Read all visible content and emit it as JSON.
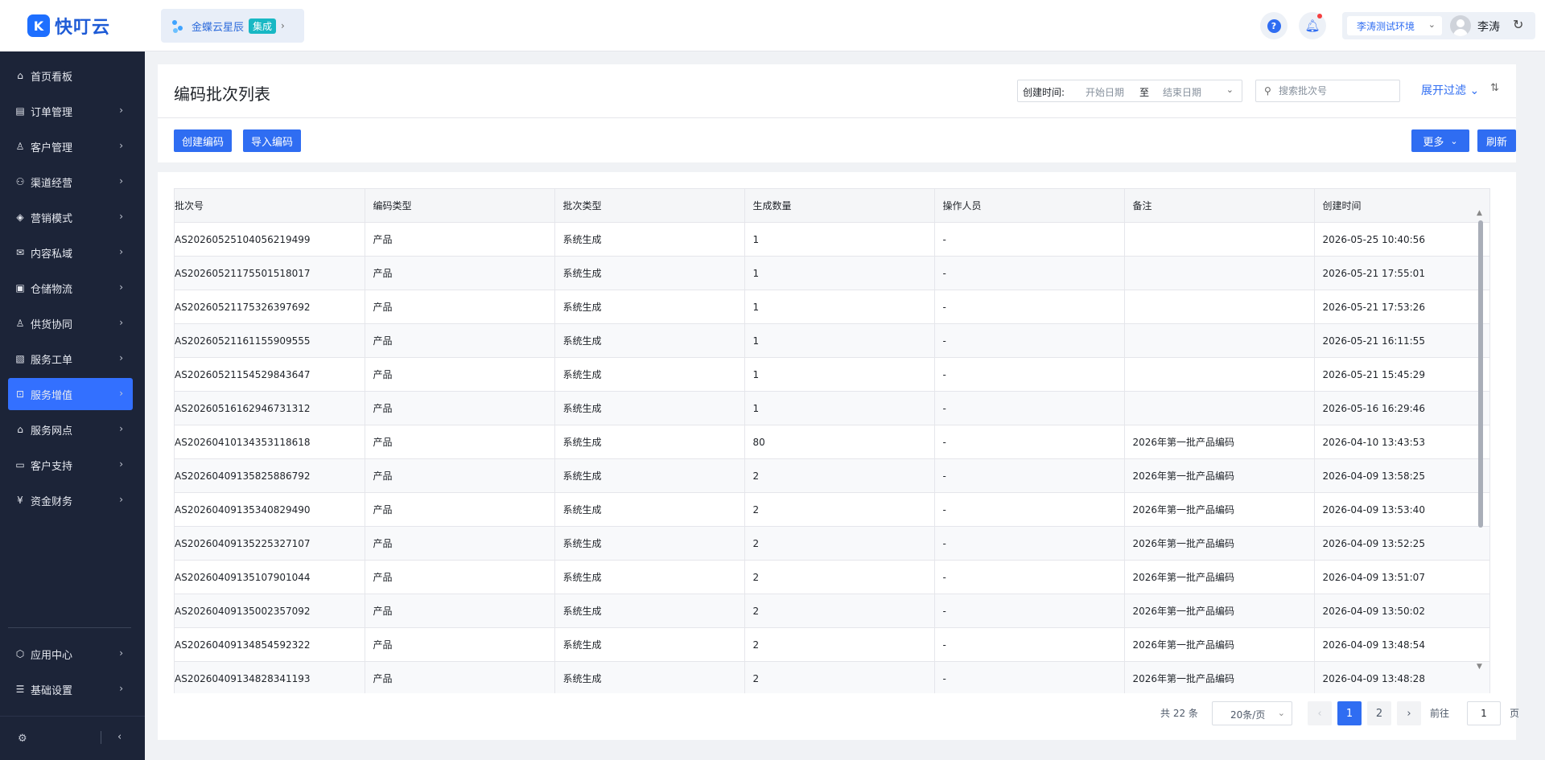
{
  "app": {
    "logo_text": "快叮云",
    "logo_mark": "K"
  },
  "sidebar": {
    "items": [
      {
        "label": "首页看板",
        "icon": "home-icon",
        "glyph": "⌂",
        "has_children": false,
        "active": false
      },
      {
        "label": "订单管理",
        "icon": "clipboard-icon",
        "glyph": "▤",
        "has_children": true,
        "active": false
      },
      {
        "label": "客户管理",
        "icon": "user-icon",
        "glyph": "♙",
        "has_children": true,
        "active": false
      },
      {
        "label": "渠道经营",
        "icon": "channel-icon",
        "glyph": "⚇",
        "has_children": true,
        "active": false
      },
      {
        "label": "营销模式",
        "icon": "tag-icon",
        "glyph": "◈",
        "has_children": true,
        "active": false
      },
      {
        "label": "内容私域",
        "icon": "mail-icon",
        "glyph": "✉",
        "has_children": true,
        "active": false
      },
      {
        "label": "仓储物流",
        "icon": "warehouse-icon",
        "glyph": "▣",
        "has_children": true,
        "active": false
      },
      {
        "label": "供货协同",
        "icon": "supplier-icon",
        "glyph": "♙",
        "has_children": true,
        "active": false
      },
      {
        "label": "服务工单",
        "icon": "ticket-icon",
        "glyph": "▧",
        "has_children": true,
        "active": false
      },
      {
        "label": "服务增值",
        "icon": "bag-icon",
        "glyph": "⊡",
        "has_children": true,
        "active": true
      },
      {
        "label": "服务网点",
        "icon": "store-icon",
        "glyph": "⌂",
        "has_children": true,
        "active": false
      },
      {
        "label": "客户支持",
        "icon": "support-icon",
        "glyph": "▭",
        "has_children": true,
        "active": false
      },
      {
        "label": "资金财务",
        "icon": "yen-icon",
        "glyph": "¥",
        "has_children": true,
        "active": false
      }
    ],
    "bottom_items": [
      {
        "label": "应用中心",
        "icon": "cube-icon",
        "glyph": "⬡",
        "has_children": true
      },
      {
        "label": "基础设置",
        "icon": "settings-icon",
        "glyph": "☰",
        "has_children": true
      }
    ]
  },
  "header": {
    "brand_name": "金蝶云星辰",
    "brand_tag": "集成",
    "env_label": "李涛测试环境",
    "user_name": "李涛"
  },
  "page": {
    "title": "编码批次列表",
    "filter": {
      "label": "创建时间:",
      "start_placeholder": "开始日期",
      "separator": "至",
      "end_placeholder": "结束日期"
    },
    "search_placeholder": "搜索批次号",
    "expand_filter_label": "展开过滤",
    "buttons": {
      "create": "创建编码",
      "import": "导入编码",
      "more": "更多",
      "refresh": "刷新"
    }
  },
  "table": {
    "columns": [
      "批次号",
      "编码类型",
      "批次类型",
      "生成数量",
      "操作人员",
      "备注",
      "创建时间"
    ],
    "rows": [
      [
        "AS20260525104056219499",
        "产品",
        "系统生成",
        "1",
        "-",
        "",
        "2026-05-25 10:40:56"
      ],
      [
        "AS20260521175501518017",
        "产品",
        "系统生成",
        "1",
        "-",
        "",
        "2026-05-21 17:55:01"
      ],
      [
        "AS20260521175326397692",
        "产品",
        "系统生成",
        "1",
        "-",
        "",
        "2026-05-21 17:53:26"
      ],
      [
        "AS20260521161155909555",
        "产品",
        "系统生成",
        "1",
        "-",
        "",
        "2026-05-21 16:11:55"
      ],
      [
        "AS20260521154529843647",
        "产品",
        "系统生成",
        "1",
        "-",
        "",
        "2026-05-21 15:45:29"
      ],
      [
        "AS20260516162946731312",
        "产品",
        "系统生成",
        "1",
        "-",
        "",
        "2026-05-16 16:29:46"
      ],
      [
        "AS20260410134353118618",
        "产品",
        "系统生成",
        "80",
        "-",
        "2026年第一批产品编码",
        "2026-04-10 13:43:53"
      ],
      [
        "AS20260409135825886792",
        "产品",
        "系统生成",
        "2",
        "-",
        "2026年第一批产品编码",
        "2026-04-09 13:58:25"
      ],
      [
        "AS20260409135340829490",
        "产品",
        "系统生成",
        "2",
        "-",
        "2026年第一批产品编码",
        "2026-04-09 13:53:40"
      ],
      [
        "AS20260409135225327107",
        "产品",
        "系统生成",
        "2",
        "-",
        "2026年第一批产品编码",
        "2026-04-09 13:52:25"
      ],
      [
        "AS20260409135107901044",
        "产品",
        "系统生成",
        "2",
        "-",
        "2026年第一批产品编码",
        "2026-04-09 13:51:07"
      ],
      [
        "AS20260409135002357092",
        "产品",
        "系统生成",
        "2",
        "-",
        "2026年第一批产品编码",
        "2026-04-09 13:50:02"
      ],
      [
        "AS20260409134854592322",
        "产品",
        "系统生成",
        "2",
        "-",
        "2026年第一批产品编码",
        "2026-04-09 13:48:54"
      ],
      [
        "AS20260409134828341193",
        "产品",
        "系统生成",
        "2",
        "-",
        "2026年第一批产品编码",
        "2026-04-09 13:48:28"
      ]
    ]
  },
  "pagination": {
    "total_label": "共 22 条",
    "page_size": "20条/页",
    "pages": [
      "1",
      "2"
    ],
    "current_page": "1",
    "goto_label": "前往",
    "goto_value": "1",
    "goto_unit": "页"
  },
  "colors": {
    "primary": "#2f6df2",
    "sidebar_bg": "#1c2438",
    "active_nav": "#3370ff"
  }
}
